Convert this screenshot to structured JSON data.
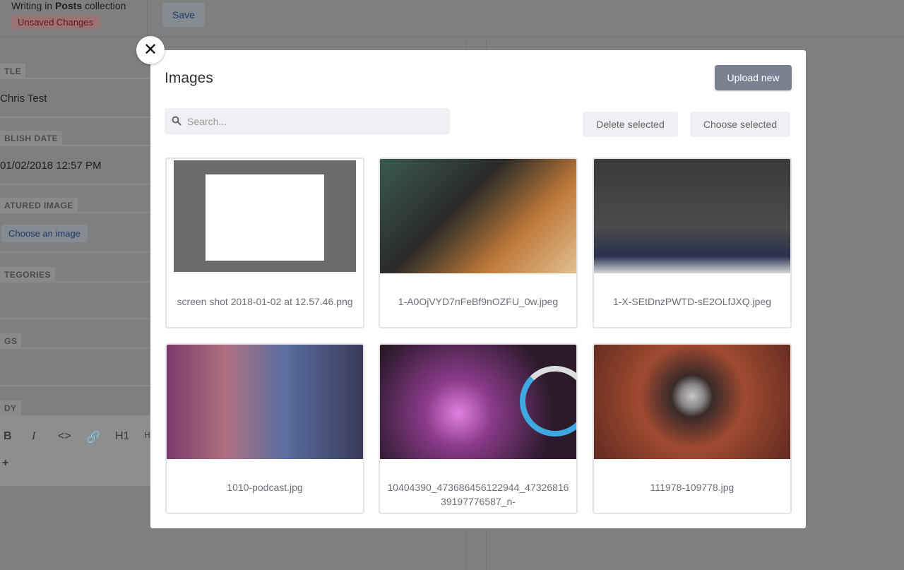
{
  "editor": {
    "writing_prefix": "Writing in ",
    "collection": "Posts",
    "writing_suffix": " collection",
    "unsaved": "Unsaved Changes",
    "save": "Save",
    "fields": [
      {
        "label": "TLE",
        "value": "Chris Test"
      },
      {
        "label": "BLISH DATE",
        "value": "01/02/2018 12:57 PM"
      },
      {
        "label": "ATURED IMAGE",
        "value": ""
      },
      {
        "label": "TEGORIES",
        "value": ""
      },
      {
        "label": "GS",
        "value": ""
      },
      {
        "label": "DY",
        "value": ""
      }
    ],
    "choose_image": "Choose an image",
    "toolbar": [
      "B",
      "I",
      "<>",
      "🔗",
      "H1",
      "H",
      "+"
    ]
  },
  "modal": {
    "title": "Images",
    "upload": "Upload new",
    "search_placeholder": "Search...",
    "delete_selected": "Delete selected",
    "choose_selected": "Choose selected",
    "images": [
      {
        "name": "screen shot 2018-01-02 at 12.57.46.png"
      },
      {
        "name": "1-A0OjVYD7nFeBf9nOZFU_0w.jpeg"
      },
      {
        "name": "1-X-SEtDnzPWTD-sE2OLfJXQ.jpeg"
      },
      {
        "name": "1010-podcast.jpg"
      },
      {
        "name": "10404390_473686456122944_4732681639197776587_n-"
      },
      {
        "name": "111978-109778.jpg"
      }
    ]
  }
}
